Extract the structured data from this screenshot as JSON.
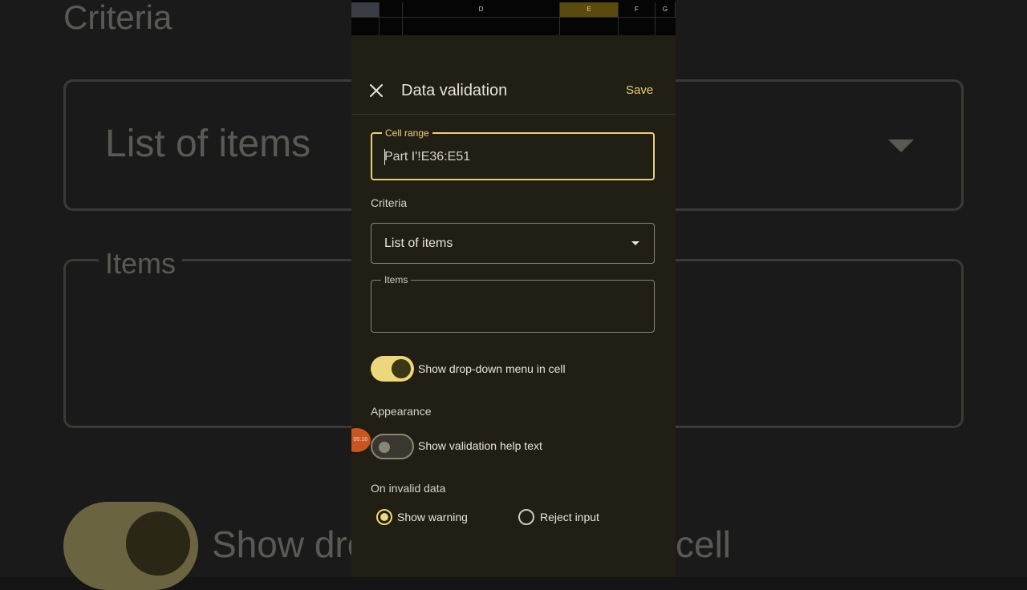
{
  "spreadsheet": {
    "columns": [
      "",
      "",
      "D",
      "E",
      "F",
      "G"
    ],
    "selected_column": "E"
  },
  "header": {
    "title": "Data validation",
    "save_label": "Save"
  },
  "cell_range": {
    "label": "Cell range",
    "value": "Part I'!E36:E51"
  },
  "criteria": {
    "label": "Criteria",
    "selected": "List of items"
  },
  "items_field": {
    "label": "Items",
    "value": ""
  },
  "dropdown_toggle": {
    "label": "Show drop-down menu in cell",
    "checked": true
  },
  "appearance": {
    "label": "Appearance",
    "help_toggle_label": "Show validation help text",
    "help_checked": false
  },
  "invalid_data": {
    "label": "On invalid data",
    "options": [
      "Show warning",
      "Reject input"
    ],
    "selected": "Show warning"
  },
  "recording_badge": "00:16",
  "background": {
    "criteria": "Criteria",
    "select_value": "List of items",
    "items": "Items",
    "toggle_label_left": "Show dro",
    "toggle_label_right": "cell"
  },
  "colors": {
    "accent": "#ecd77d",
    "panel": "#211e14",
    "selected_column": "#5a4a10"
  }
}
